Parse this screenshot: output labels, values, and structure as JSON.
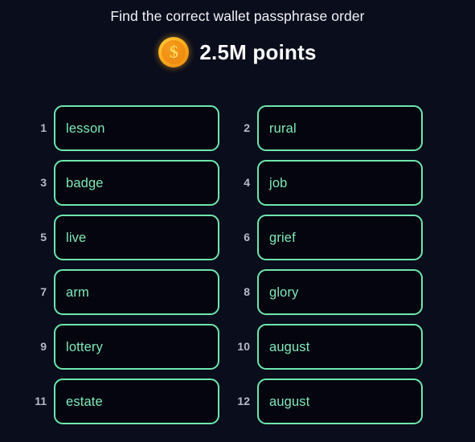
{
  "header": {
    "title": "Find the correct wallet passphrase order",
    "reward": {
      "coin_icon": "gold-coin-dollar-icon",
      "coin_glyph": "$",
      "amount_label": "2.5M points"
    }
  },
  "colors": {
    "page_background": "#0a0d1c",
    "box_background": "#04050f",
    "box_border": "#6ee7ad",
    "word_text": "#7fe9b9",
    "index_text": "#b9bac9",
    "title_text": "#f2f3f7",
    "points_text": "#ffffff",
    "coin_gold": "#fcb320"
  },
  "passphrase": {
    "columns": 2,
    "rows": 6,
    "slots": [
      {
        "index": "1",
        "word": "lesson"
      },
      {
        "index": "2",
        "word": "rural"
      },
      {
        "index": "3",
        "word": "badge"
      },
      {
        "index": "4",
        "word": "job"
      },
      {
        "index": "5",
        "word": "live"
      },
      {
        "index": "6",
        "word": "grief"
      },
      {
        "index": "7",
        "word": "arm"
      },
      {
        "index": "8",
        "word": "glory"
      },
      {
        "index": "9",
        "word": "lottery"
      },
      {
        "index": "10",
        "word": "august"
      },
      {
        "index": "11",
        "word": "estate"
      },
      {
        "index": "12",
        "word": "august"
      }
    ]
  }
}
